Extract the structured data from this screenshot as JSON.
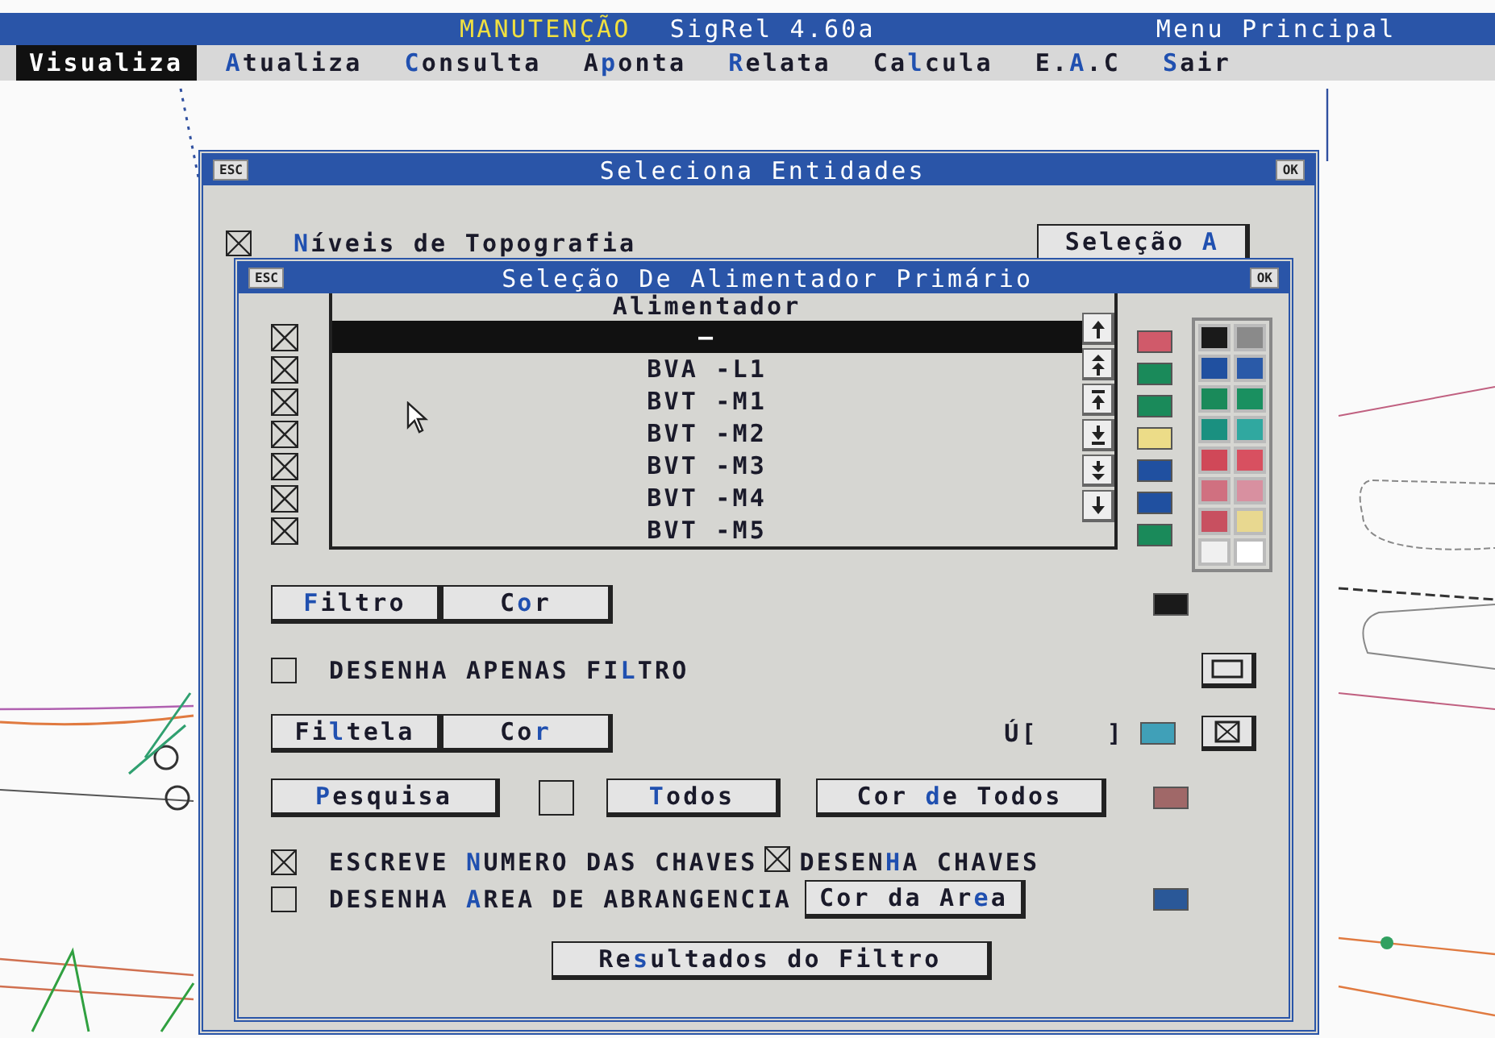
{
  "app_bar": {
    "mode": "MANUTENÇÃO",
    "title": "SigRel 4.60a",
    "context": "Menu Principal"
  },
  "menu": [
    {
      "label": "**V**isualiza",
      "selected": true
    },
    {
      "label": "**A**tualiza",
      "selected": false
    },
    {
      "label": "**C**onsulta",
      "selected": false
    },
    {
      "label": "A**p**onta",
      "selected": false
    },
    {
      "label": "**R**elata",
      "selected": false
    },
    {
      "label": "Ca**l**cula",
      "selected": false
    },
    {
      "label": "E.**A**.C",
      "selected": false
    },
    {
      "label": "**S**air",
      "selected": false
    }
  ],
  "outer_dialog": {
    "close": "ESC",
    "title": "Seleciona Entidades",
    "ok": "OK",
    "topography": {
      "label": "**N**íveis de Topografia",
      "checked": true
    },
    "select_button": "Seleção **A**"
  },
  "inner_dialog": {
    "close": "ESC",
    "title": "Seleção De Alimentador Primário",
    "ok": "OK",
    "list": {
      "header": "Alimentador",
      "rows": [
        {
          "label": "–",
          "checked": true,
          "selected": true,
          "color": "#d05a6a"
        },
        {
          "label": "BVA -L1",
          "checked": true,
          "selected": false,
          "color": "#1a8a5a"
        },
        {
          "label": "BVT -M1",
          "checked": true,
          "selected": false,
          "color": "#1a8a5a"
        },
        {
          "label": "BVT -M2",
          "checked": true,
          "selected": false,
          "color": "#ecdc88"
        },
        {
          "label": "BVT -M3",
          "checked": true,
          "selected": false,
          "color": "#2050a0"
        },
        {
          "label": "BVT -M4",
          "checked": true,
          "selected": false,
          "color": "#2050a0"
        },
        {
          "label": "BVT -M5",
          "checked": true,
          "selected": false,
          "color": "#1a8a5a"
        }
      ]
    },
    "palette": [
      {
        "color": "#1a1a1a"
      },
      {
        "color": "#8a8a8a"
      },
      {
        "color": "#2050a0"
      },
      {
        "color": "#2a5aa8"
      },
      {
        "color": "#1a8a5a"
      },
      {
        "color": "#1a9060"
      },
      {
        "color": "#1a9080"
      },
      {
        "color": "#30a8a0"
      },
      {
        "color": "#d04858"
      },
      {
        "color": "#d85060"
      },
      {
        "color": "#d07080"
      },
      {
        "color": "#d890a0"
      },
      {
        "color": "#c85060"
      },
      {
        "color": "#e8d890"
      },
      {
        "color": "#f0f0f0"
      },
      {
        "color": "#ffffff"
      }
    ],
    "filter": {
      "button": "**F**iltro",
      "color_button": "C**o**r",
      "color": "#1a1a1a"
    },
    "draw_only_filter": {
      "label": "DESENHA APENAS FI**L**TRO",
      "checked": false
    },
    "filtela": {
      "button": "Fi**l**tela",
      "color_button": "Co**r**",
      "range": "Ú[    ]",
      "color": "#40a0b8"
    },
    "search": {
      "button": "**P**esquisa",
      "checked": false,
      "all_button": "**T**odos",
      "all_color_button": "Cor **d**e Todos",
      "color": "#a06868"
    },
    "write_numbers": {
      "label": "ESCREVE **N**UMERO DAS CHAVES",
      "checked": true
    },
    "draw_keys": {
      "label": "DESEN**H**A CHAVES",
      "checked": true
    },
    "draw_area": {
      "label": "DESENHA **A**REA DE ABRANGENCIA",
      "checked": false
    },
    "area_color": {
      "button": "Cor da Ar**e**a",
      "color": "#2a5898"
    },
    "results_button": "Re**s**ultados do Filtro"
  }
}
